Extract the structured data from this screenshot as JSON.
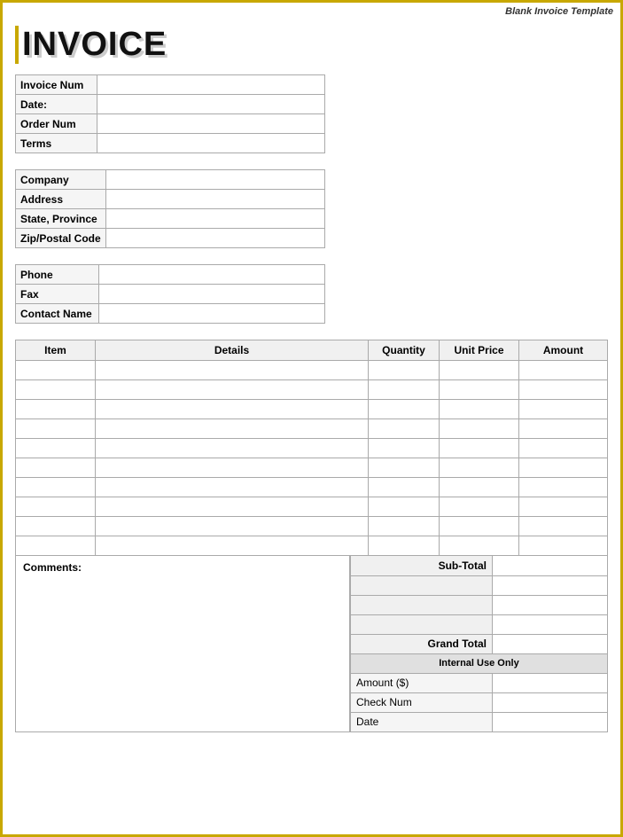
{
  "page": {
    "top_label": "Blank Invoice Template",
    "invoice_title": "INVOICE"
  },
  "top_fields": [
    {
      "label": "Invoice Num",
      "value": ""
    },
    {
      "label": "Date:",
      "value": ""
    },
    {
      "label": "Order Num",
      "value": ""
    },
    {
      "label": "Terms",
      "value": ""
    }
  ],
  "company_fields": [
    {
      "label": "Company",
      "value": ""
    },
    {
      "label": "Address",
      "value": ""
    },
    {
      "label": "State, Province",
      "value": ""
    },
    {
      "label": "Zip/Postal Code",
      "value": ""
    }
  ],
  "contact_fields": [
    {
      "label": "Phone",
      "value": ""
    },
    {
      "label": "Fax",
      "value": ""
    },
    {
      "label": "Contact Name",
      "value": ""
    }
  ],
  "table_headers": {
    "item": "Item",
    "details": "Details",
    "quantity": "Quantity",
    "unit_price": "Unit Price",
    "amount": "Amount"
  },
  "item_rows": 10,
  "comments_label": "Comments:",
  "totals": [
    {
      "label": "Sub-Total",
      "value": ""
    },
    {
      "label": "",
      "value": ""
    },
    {
      "label": "",
      "value": ""
    },
    {
      "label": "",
      "value": ""
    },
    {
      "label": "Grand Total",
      "value": ""
    }
  ],
  "internal_section": {
    "header": "Internal Use Only",
    "rows": [
      {
        "label": "Amount ($)",
        "value": ""
      },
      {
        "label": "Check Num",
        "value": ""
      },
      {
        "label": "Date",
        "value": ""
      }
    ]
  }
}
